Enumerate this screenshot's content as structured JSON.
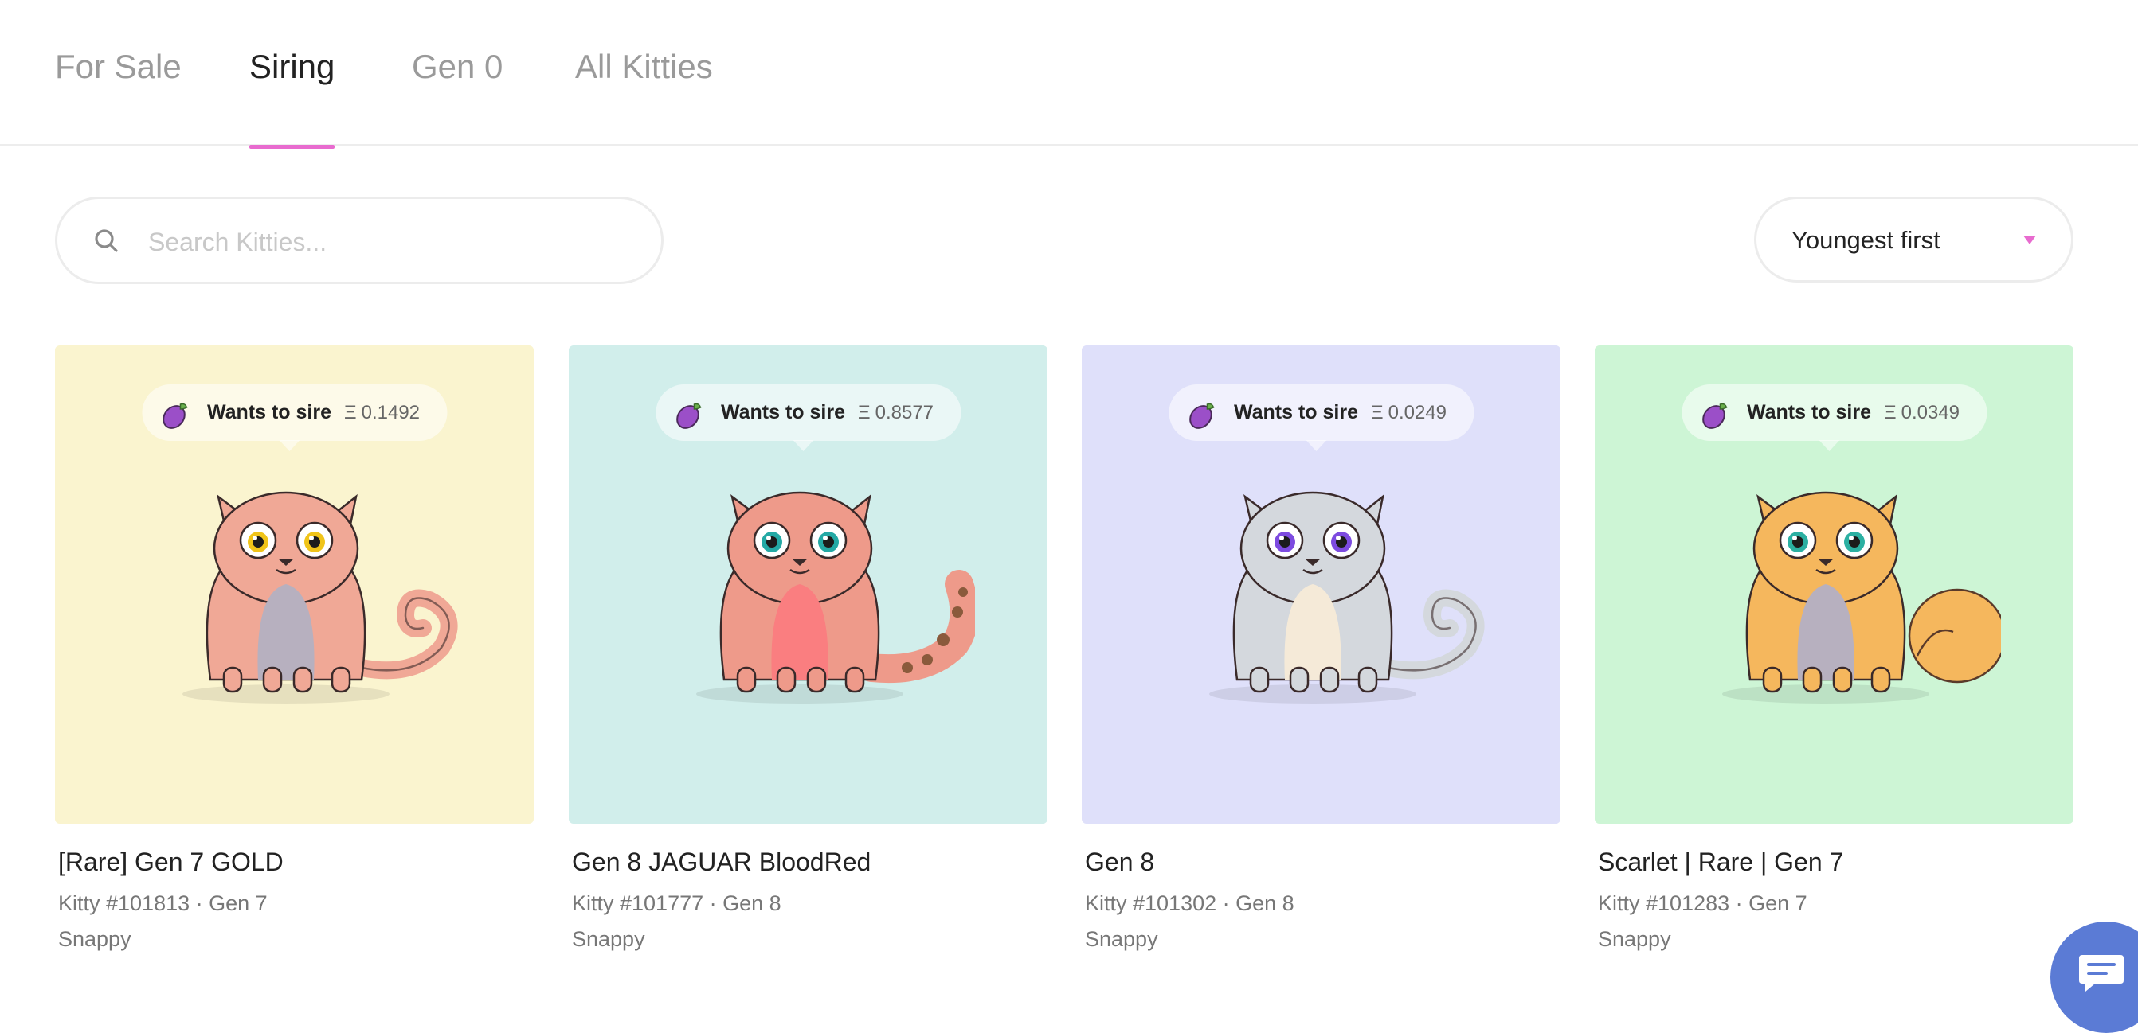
{
  "tabs": [
    {
      "label": "For Sale"
    },
    {
      "label": "Siring"
    },
    {
      "label": "Gen 0"
    },
    {
      "label": "All Kitties"
    }
  ],
  "search": {
    "placeholder": "Search Kitties..."
  },
  "sort": {
    "selected": "Youngest first"
  },
  "colors": {
    "accent": "#e86bcf",
    "chat": "#5b7bd5"
  },
  "cards": [
    {
      "bubble_label": "Wants to sire",
      "currency": "Ξ",
      "price": "0.1492",
      "title": "[Rare] Gen 7 GOLD",
      "meta": "Kitty #101813 · Gen 7",
      "speed": "Snappy",
      "bg": "#faf4cf",
      "cat_color": "#f0a896",
      "belly": "#b7b0bf",
      "eye": "#f0c419",
      "tail": "curl"
    },
    {
      "bubble_label": "Wants to sire",
      "currency": "Ξ",
      "price": "0.8577",
      "title": "Gen 8 JAGUAR BloodRed",
      "meta": "Kitty #101777 · Gen 8",
      "speed": "Snappy",
      "bg": "#d1eeeb",
      "cat_color": "#ee9a8a",
      "belly": "#fa7e80",
      "eye": "#24a9a5",
      "tail": "bushy"
    },
    {
      "bubble_label": "Wants to sire",
      "currency": "Ξ",
      "price": "0.0249",
      "title": "Gen 8",
      "meta": "Kitty #101302 · Gen 8",
      "speed": "Snappy",
      "bg": "#dfe0fa",
      "cat_color": "#d4d8dd",
      "belly": "#f5ead8",
      "eye": "#7d4be0",
      "tail": "curl"
    },
    {
      "bubble_label": "Wants to sire",
      "currency": "Ξ",
      "price": "0.0349",
      "title": "Scarlet | Rare | Gen 7",
      "meta": "Kitty #101283 · Gen 7",
      "speed": "Snappy",
      "bg": "#cdf5d5",
      "cat_color": "#f5b75d",
      "belly": "#b7b0bf",
      "eye": "#2bb0a2",
      "tail": "fluffy"
    }
  ]
}
